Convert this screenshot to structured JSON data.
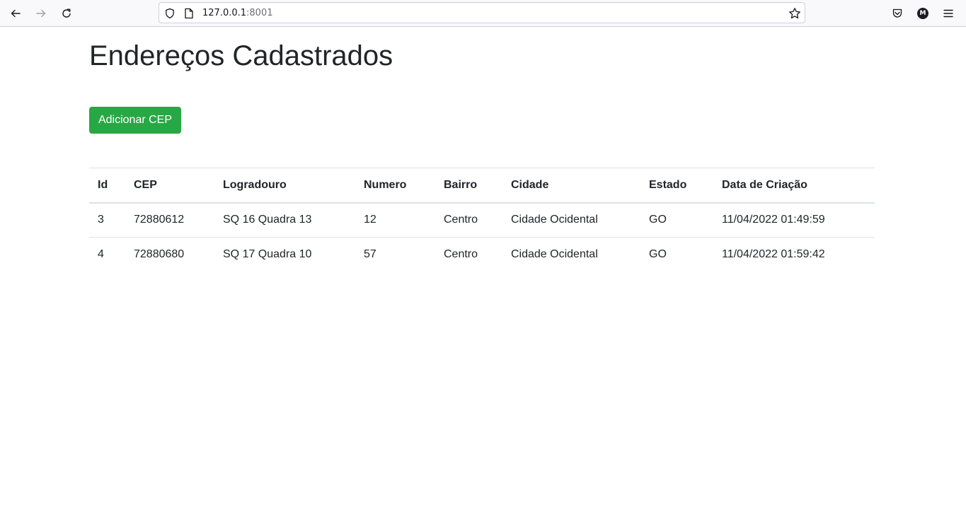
{
  "browser": {
    "url_host": "127.0.0.1",
    "url_port": ":8001",
    "account_initial": "M"
  },
  "page": {
    "title": "Endereços Cadastrados",
    "add_button_label": "Adicionar CEP",
    "button_color": "#28a745"
  },
  "table": {
    "headers": [
      "Id",
      "CEP",
      "Logradouro",
      "Numero",
      "Bairro",
      "Cidade",
      "Estado",
      "Data de Criação"
    ],
    "rows": [
      [
        "3",
        "72880612",
        "SQ 16 Quadra 13",
        "12",
        "Centro",
        "Cidade Ocidental",
        "GO",
        "11/04/2022 01:49:59"
      ],
      [
        "4",
        "72880680",
        "SQ 17 Quadra 10",
        "57",
        "Centro",
        "Cidade Ocidental",
        "GO",
        "11/04/2022 01:59:42"
      ]
    ]
  }
}
